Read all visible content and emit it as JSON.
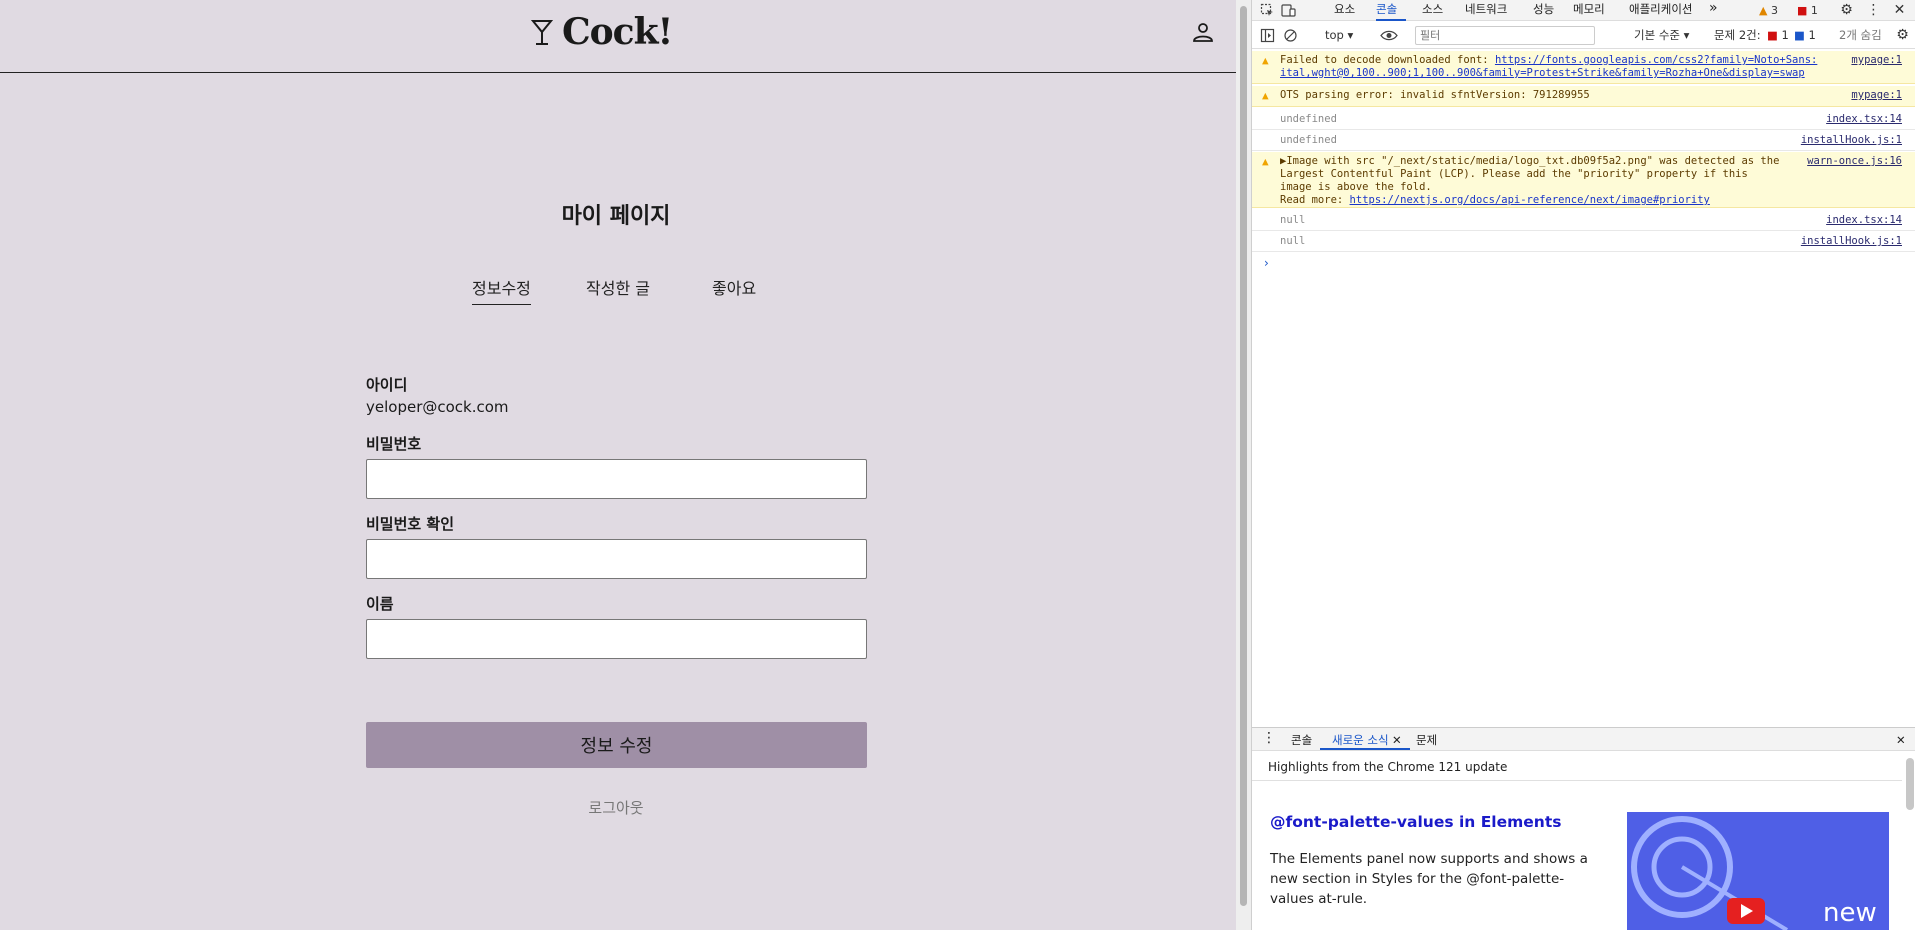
{
  "app": {
    "logo_text": "Cock!",
    "page_title": "마이 페이지",
    "tabs": [
      {
        "label": "정보수정",
        "active": true
      },
      {
        "label": "작성한 글",
        "active": false
      },
      {
        "label": "좋아요",
        "active": false
      }
    ],
    "form": {
      "id_label": "아이디",
      "id_value": "yeloper@cock.com",
      "password_label": "비밀번호",
      "password_value": "",
      "confirm_label": "비밀번호 확인",
      "confirm_value": "",
      "name_label": "이름",
      "name_value": ""
    },
    "submit_label": "정보 수정",
    "logout_label": "로그아웃"
  },
  "devtools": {
    "panel_tabs": [
      "요소",
      "콘솔",
      "소스",
      "네트워크",
      "성능",
      "메모리",
      "애플리케이션"
    ],
    "active_panel": "콘솔",
    "more_tabs": "»",
    "warnings_count": "3",
    "errors_count": "1",
    "context": "top ▾",
    "filter_placeholder": "필터",
    "level": "기본 수준 ▾",
    "issues_label": "문제 2건:",
    "issues_error": "1",
    "issues_info": "1",
    "hidden_label": "2개 숨김",
    "logs": [
      {
        "type": "warn",
        "text_prefix": "Failed to decode downloaded font: ",
        "link": "https://fonts.googleapis.com/css2?family=Noto+Sans:ital,wght@0,100..900;1,100..900&family=Protest+Strike&family=Rozha+One&display=swap",
        "source": "mypage:1"
      },
      {
        "type": "warn",
        "text_prefix": "OTS parsing error: invalid sfntVersion: 791289955",
        "source": "mypage:1"
      },
      {
        "type": "plain",
        "text_prefix": "undefined",
        "source": "index.tsx:14"
      },
      {
        "type": "plain",
        "text_prefix": "undefined",
        "source": "installHook.js:1"
      },
      {
        "type": "warn",
        "text_prefix": "▶Image with src \"/_next/static/media/logo_txt.db09f5a2.png\" was detected as the Largest Contentful Paint (LCP). Please add the \"priority\" property if this image is above the fold.",
        "more_label": "Read more: ",
        "link": "https://nextjs.org/docs/api-reference/next/image#priority",
        "source": "warn-once.js:16"
      },
      {
        "type": "plain",
        "text_prefix": "null",
        "source": "index.tsx:14"
      },
      {
        "type": "plain",
        "text_prefix": "null",
        "source": "installHook.js:1"
      }
    ],
    "prompt": "›",
    "drawer_tabs": [
      "콘솔",
      "새로운 소식",
      "문제"
    ],
    "drawer_active": "새로운 소식",
    "news_header": "Highlights from the Chrome 121 update",
    "news_title": "@font-palette-values in Elements",
    "news_desc": "The Elements panel now supports and shows a new section in Styles for the @font-palette-values at-rule.",
    "thumb_label": "new",
    "colors": {
      "accent": "#1a56c9",
      "warn_bg": "#fefbd7",
      "thumb_bg": "#4f5fe6"
    }
  }
}
